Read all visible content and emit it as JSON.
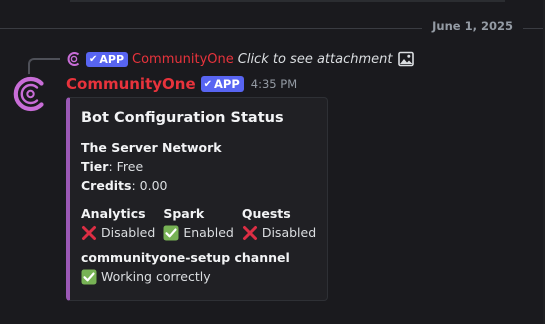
{
  "divider": {
    "date": "June 1, 2025"
  },
  "reply": {
    "badge": "APP",
    "author": "CommunityOne",
    "text": "Click to see attachment"
  },
  "message": {
    "author": "CommunityOne",
    "badge": "APP",
    "timestamp": "4:35 PM",
    "author_color": "#e8333c"
  },
  "embed": {
    "accent_color": "#9b59b6",
    "title": "Bot Configuration Status",
    "server_name": "The Server Network",
    "tier_label": "Tier",
    "tier_value": ": Free",
    "credits_label": "Credits",
    "credits_value": ": 0.00",
    "fields": [
      {
        "name": "Analytics",
        "icon": "cross-mark-icon",
        "status": "Disabled"
      },
      {
        "name": "Spark",
        "icon": "check-mark-icon",
        "status": "Enabled"
      },
      {
        "name": "Quests",
        "icon": "cross-mark-icon",
        "status": "Disabled"
      }
    ],
    "channel_name": "communityone-setup channel",
    "channel_icon": "check-mark-icon",
    "channel_status": "Working correctly"
  }
}
